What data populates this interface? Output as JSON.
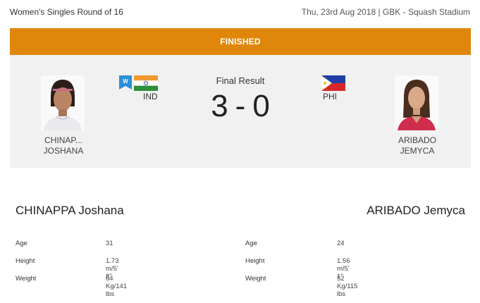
{
  "header": {
    "event_title": "Women's Singles Round of 16",
    "event_meta": "Thu, 23rd Aug 2018 | GBK - Squash Stadium"
  },
  "status": {
    "label": "FINISHED",
    "color": "#e0870b"
  },
  "result": {
    "label": "Final Result",
    "score_left": "3",
    "separator": "-",
    "score_right": "0"
  },
  "player_left": {
    "short_name_line1": "CHINAP...",
    "short_name_line2": "JOSHANA",
    "country": "IND",
    "flag_icon": "india-flag-icon",
    "badge_icon": "winner-badge-icon",
    "badge_letter": "W",
    "full_name": "CHINAPPA Joshana",
    "stats": [
      {
        "label": "Age",
        "value": "31"
      },
      {
        "label": "Height",
        "value": "1.73 m/5' 8''"
      },
      {
        "label": "Weight",
        "value": "64 Kg/141 lbs"
      }
    ]
  },
  "player_right": {
    "short_name_line1": "ARIBADO",
    "short_name_line2": "JEMYCA",
    "country": "PHI",
    "flag_icon": "philippines-flag-icon",
    "full_name": "ARIBADO Jemyca",
    "stats": [
      {
        "label": "Age",
        "value": "24"
      },
      {
        "label": "Height",
        "value": "1.56 m/5' 1''"
      },
      {
        "label": "Weight",
        "value": "52 Kg/115 lbs"
      }
    ]
  }
}
